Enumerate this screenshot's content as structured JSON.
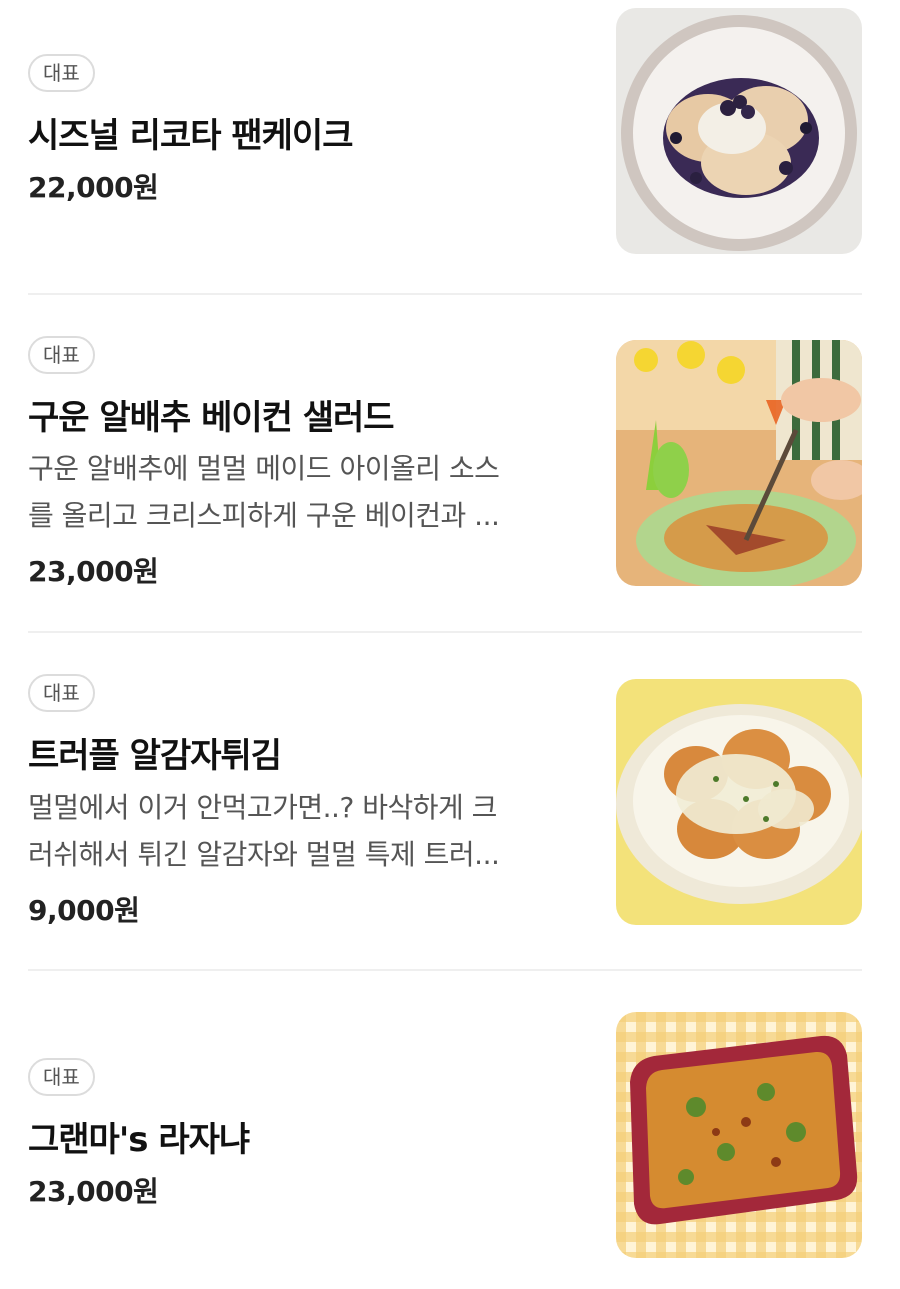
{
  "menu": {
    "items": [
      {
        "badge": "대표",
        "name": "시즈널 리코타 팬케이크",
        "description": [],
        "price": "22,000원",
        "image": "ricotta-pancake-photo"
      },
      {
        "badge": "대표",
        "name": "구운 알배추 베이컨 샐러드",
        "description": [
          "구운 알배추에 멀멀 메이드 아이올리 소스",
          "를 올리고 크리스피하게 구운 베이컨과 ..."
        ],
        "price": "23,000원",
        "image": "cabbage-bacon-salad-photo"
      },
      {
        "badge": "대표",
        "name": "트러플 알감자튀김",
        "description": [
          "멀멀에서 이거 안먹고가면..? 바삭하게 크",
          "러쉬해서 튀긴 알감자와 멀멀 특제 트러..."
        ],
        "price": "9,000원",
        "image": "truffle-potato-photo"
      },
      {
        "badge": "대표",
        "name": "그랜마's 라자냐",
        "description": [],
        "price": "23,000원",
        "image": "lasagna-photo"
      }
    ]
  }
}
